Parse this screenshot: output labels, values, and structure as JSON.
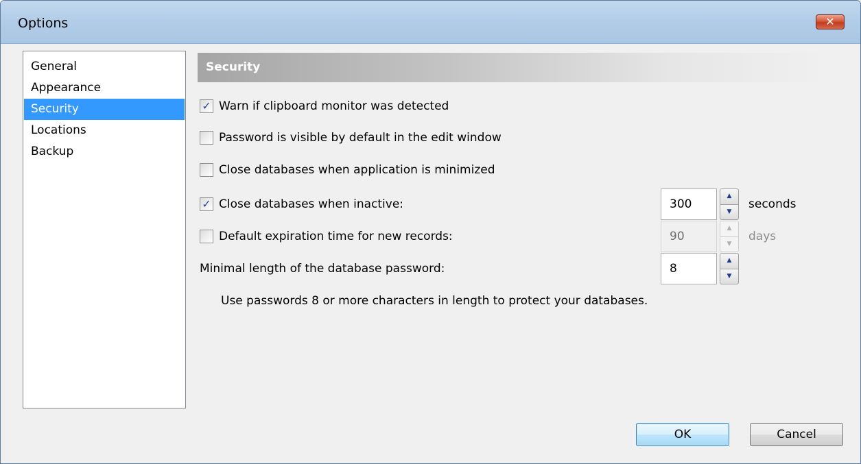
{
  "window": {
    "title": "Options",
    "close_glyph": "✕"
  },
  "nav": {
    "items": [
      {
        "label": "General",
        "selected": false
      },
      {
        "label": "Appearance",
        "selected": false
      },
      {
        "label": "Security",
        "selected": true
      },
      {
        "label": "Locations",
        "selected": false
      },
      {
        "label": "Backup",
        "selected": false
      }
    ]
  },
  "section": {
    "title": "Security"
  },
  "options": {
    "warn_clipboard": {
      "label": "Warn if clipboard monitor was detected",
      "checked": true
    },
    "password_visible": {
      "label": "Password is visible by default in the edit window",
      "checked": false
    },
    "close_minimized": {
      "label": "Close databases when application is minimized",
      "checked": false
    },
    "close_inactive": {
      "label": "Close databases when inactive:",
      "checked": true,
      "value": "300",
      "unit": "seconds"
    },
    "default_expiration": {
      "label": "Default expiration time for new records:",
      "checked": false,
      "value": "90",
      "unit": "days",
      "disabled": true
    },
    "min_password_length": {
      "label": "Minimal length of the database password:",
      "value": "8"
    }
  },
  "hint": "Use passwords 8 or more characters in length to protect your databases.",
  "buttons": {
    "ok": "OK",
    "cancel": "Cancel"
  },
  "glyphs": {
    "check": "✓",
    "spin_up": "▲",
    "spin_down": "▼"
  },
  "colors": {
    "selection": "#3399ff",
    "titlebar": "#b3cde8",
    "close": "#c43a1c"
  }
}
